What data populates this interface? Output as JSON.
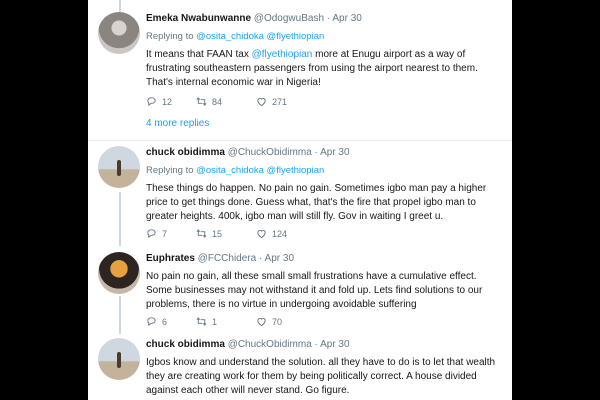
{
  "tweets": [
    {
      "name": "Emeka Nwabunwanne",
      "handle": "@OdogwuBash",
      "date": "· Apr 30",
      "replying_prefix": "Replying to ",
      "replying_to": "@osita_chidoka @flyethiopian",
      "text_before": "It means that FAAN tax ",
      "text_mention": "@flyethiopian",
      "text_after": " more at Enugu airport as a way of frustrating southeastern passengers from using the airport nearest to them. That's internal economic war in Nigeria!",
      "replies": "12",
      "retweets": "84",
      "likes": "271"
    },
    {
      "name": "chuck obidimma",
      "handle": "@ChuckObidimma",
      "date": "· Apr 30",
      "replying_prefix": "Replying to ",
      "replying_to": "@osita_chidoka @flyethiopian",
      "text": "These things do happen. No pain no gain. Sometimes igbo man pay a higher price to get things done. Guess what, that's the fire that propel igbo man to greater heights.  400k, igbo man will still fly. Gov in waiting I greet u.",
      "replies": "7",
      "retweets": "15",
      "likes": "124"
    },
    {
      "name": "Euphrates",
      "handle": "@FCChidera",
      "date": "· Apr 30",
      "text": "No pain no gain, all these small small frustrations have a cumulative effect. Some businesses may not withstand it and fold up. Lets find solutions to our problems, there is no virtue in undergoing avoidable suffering",
      "replies": "6",
      "retweets": "1",
      "likes": "70"
    },
    {
      "name": "chuck obidimma",
      "handle": "@ChuckObidimma",
      "date": "· Apr 30",
      "text": "Igbos know and understand the solution. all they have to do is to let that wealth they are creating work for them by being politically correct. A house divided against each other will never stand. Go figure."
    }
  ],
  "more_replies": "4 more replies",
  "icons": [
    "reply-icon",
    "retweet-icon",
    "like-icon"
  ],
  "colors": {
    "link": "#1da1f2",
    "meta": "#657786",
    "text": "#14171a"
  }
}
